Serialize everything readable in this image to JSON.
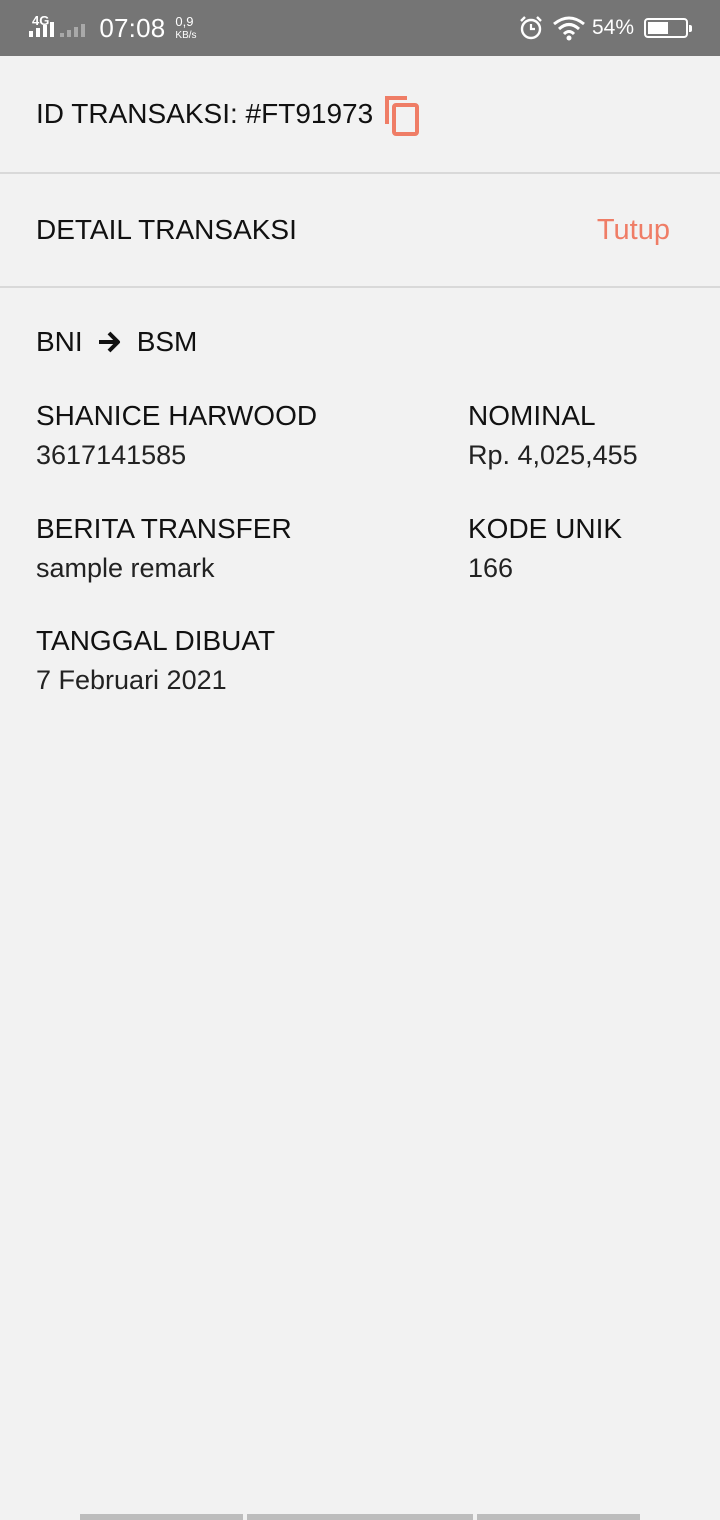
{
  "status_bar": {
    "network": "4G",
    "time": "07:08",
    "speed_value": "0,9",
    "speed_unit": "KB/s",
    "battery_percent": "54%"
  },
  "transaction": {
    "id_label": "ID TRANSAKSI: #FT91973",
    "detail_title": "DETAIL TRANSAKSI",
    "close_label": "Tutup",
    "route_from": "BNI",
    "route_to": "BSM",
    "fields": {
      "recipient_name": "SHANICE HARWOOD",
      "account_number": "3617141585",
      "nominal_label": "NOMINAL",
      "nominal_value": "Rp. 4,025,455",
      "remark_label": "BERITA TRANSFER",
      "remark_value": "sample remark",
      "unique_code_label": "KODE UNIK",
      "unique_code_value": "166",
      "date_label": "TANGGAL DIBUAT",
      "date_value": "7 Februari 2021"
    }
  },
  "colors": {
    "accent": "#ef7d66",
    "background": "#f2f2f2",
    "status_bar": "#757575"
  }
}
